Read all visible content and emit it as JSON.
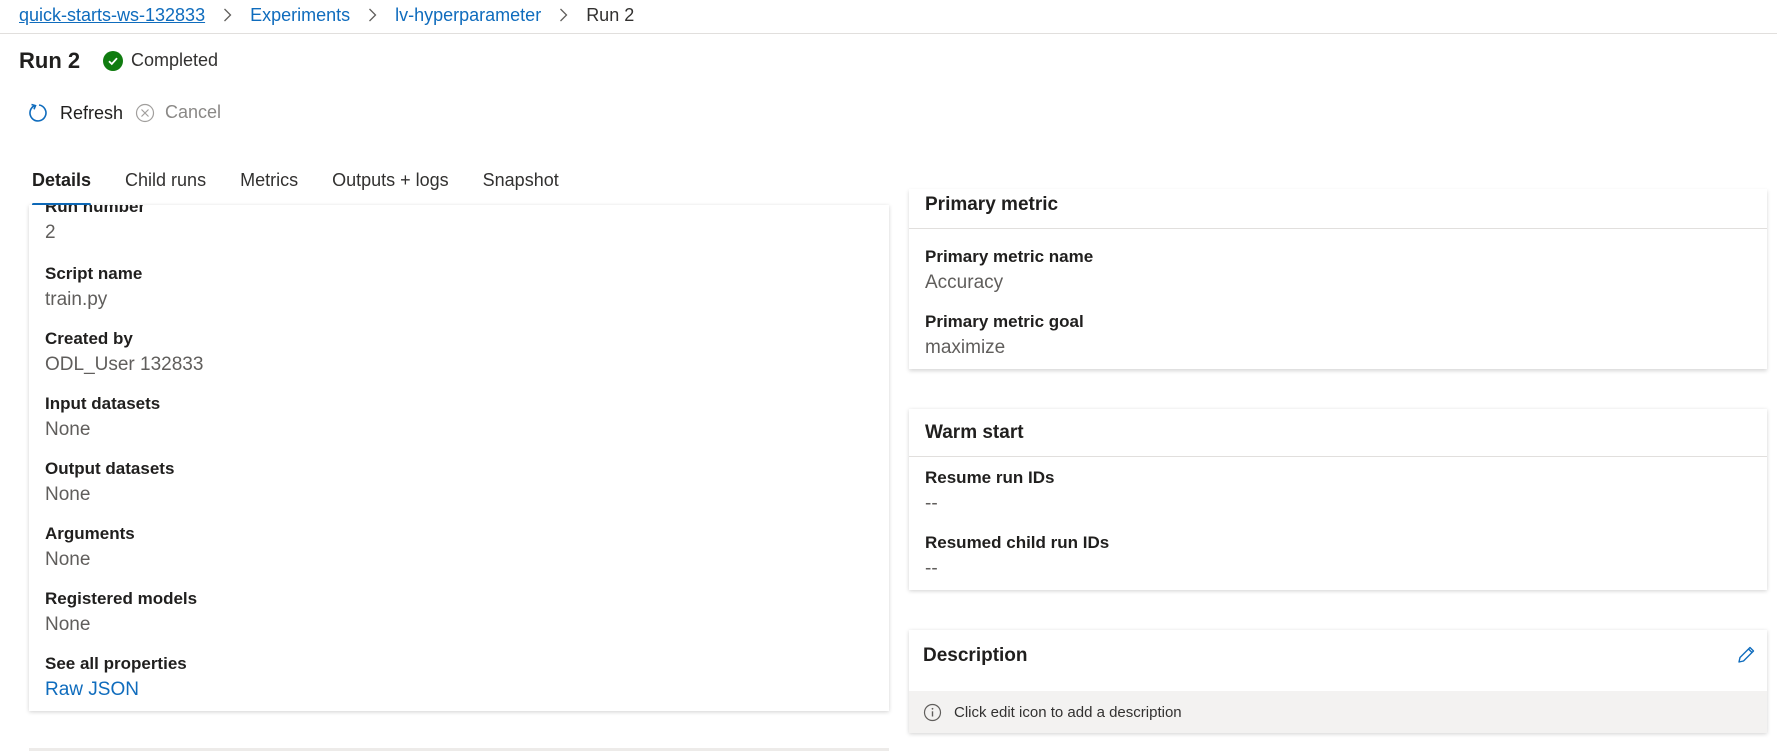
{
  "breadcrumb": {
    "workspace": "quick-starts-ws-132833",
    "experiments": "Experiments",
    "experiment": "lv-hyperparameter",
    "current": "Run 2"
  },
  "header": {
    "title": "Run 2",
    "status": "Completed",
    "status_color": "#107c10"
  },
  "commands": {
    "refresh": "Refresh",
    "cancel": "Cancel"
  },
  "tabs": [
    "Details",
    "Child runs",
    "Metrics",
    "Outputs + logs",
    "Snapshot"
  ],
  "details": {
    "run_number": {
      "label": "Run number",
      "value": "2"
    },
    "script_name": {
      "label": "Script name",
      "value": "train.py"
    },
    "created_by": {
      "label": "Created by",
      "value": "ODL_User 132833"
    },
    "input_datasets": {
      "label": "Input datasets",
      "value": "None"
    },
    "output_datasets": {
      "label": "Output datasets",
      "value": "None"
    },
    "arguments": {
      "label": "Arguments",
      "value": "None"
    },
    "registered_models": {
      "label": "Registered models",
      "value": "None"
    },
    "see_all": {
      "label": "See all properties",
      "value": "Raw JSON"
    }
  },
  "primary_metric": {
    "title": "Primary metric",
    "name_label": "Primary metric name",
    "name_value": "Accuracy",
    "goal_label": "Primary metric goal",
    "goal_value": "maximize"
  },
  "warm_start": {
    "title": "Warm start",
    "resume_label": "Resume run IDs",
    "resume_value": "--",
    "resumed_child_label": "Resumed child run IDs",
    "resumed_child_value": "--"
  },
  "description": {
    "title": "Description",
    "info": "Click edit icon to add a description"
  },
  "colors": {
    "accent": "#0f6cbd",
    "success": "#107c10"
  }
}
